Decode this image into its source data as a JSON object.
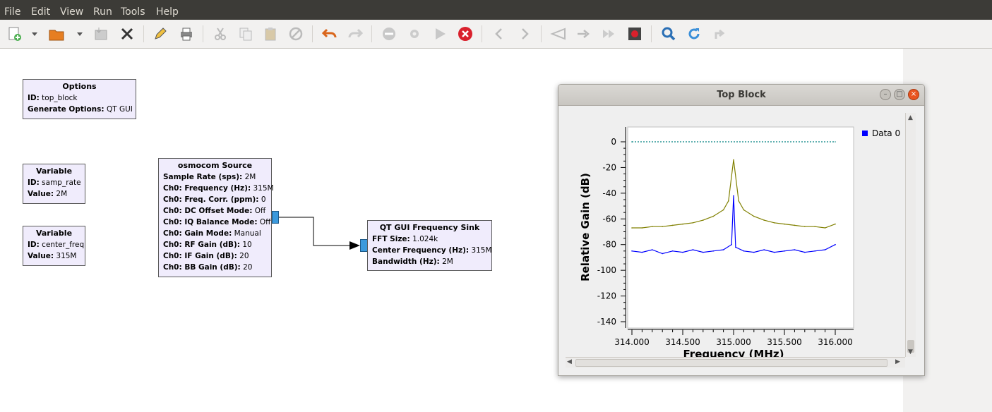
{
  "menu": [
    "File",
    "Edit",
    "View",
    "Run",
    "Tools",
    "Help"
  ],
  "toolbar_icons": [
    "new-icon",
    "dropdown-icon",
    "open-icon",
    "dropdown-icon",
    "save-icon",
    "close-icon",
    "edit-icon",
    "print-icon",
    "cut-icon",
    "copy-icon",
    "paste-icon",
    "disable-icon",
    "undo-icon",
    "redo-icon",
    "remove-icon",
    "settings-icon",
    "play-icon",
    "stop-icon",
    "back-icon",
    "forward-icon",
    "rotate-left-icon",
    "rotate-right-icon",
    "skip-icon",
    "record-icon",
    "search-icon",
    "reload-icon",
    "redo-alt-icon"
  ],
  "blocks": {
    "options": {
      "title": "Options",
      "rows": [
        {
          "k": "ID:",
          "v": "top_block"
        },
        {
          "k": "Generate Options:",
          "v": "QT GUI"
        }
      ]
    },
    "var_samp": {
      "title": "Variable",
      "rows": [
        {
          "k": "ID:",
          "v": "samp_rate"
        },
        {
          "k": "Value:",
          "v": "2M"
        }
      ]
    },
    "var_center": {
      "title": "Variable",
      "rows": [
        {
          "k": "ID:",
          "v": "center_freq"
        },
        {
          "k": "Value:",
          "v": "315M"
        }
      ]
    },
    "osmocom": {
      "title": "osmocom Source",
      "rows": [
        {
          "k": "Sample Rate (sps):",
          "v": "2M"
        },
        {
          "k": "Ch0: Frequency (Hz):",
          "v": "315M"
        },
        {
          "k": "Ch0: Freq. Corr. (ppm):",
          "v": "0"
        },
        {
          "k": "Ch0: DC Offset Mode:",
          "v": "Off"
        },
        {
          "k": "Ch0: IQ Balance Mode:",
          "v": "Off"
        },
        {
          "k": "Ch0: Gain Mode:",
          "v": "Manual"
        },
        {
          "k": "Ch0: RF Gain (dB):",
          "v": "10"
        },
        {
          "k": "Ch0: IF Gain (dB):",
          "v": "20"
        },
        {
          "k": "Ch0: BB Gain (dB):",
          "v": "20"
        }
      ]
    },
    "freq_sink": {
      "title": "QT GUI Frequency Sink",
      "rows": [
        {
          "k": "FFT Size:",
          "v": "1.024k"
        },
        {
          "k": "Center Frequency (Hz):",
          "v": "315M"
        },
        {
          "k": "Bandwidth (Hz):",
          "v": "2M"
        }
      ]
    }
  },
  "window": {
    "title": "Top Block"
  },
  "chart_data": {
    "type": "line",
    "xlabel": "Frequency (MHz)",
    "ylabel": "Relative Gain (dB)",
    "xlim": [
      314.0,
      316.0
    ],
    "ylim": [
      -140,
      0
    ],
    "x_ticks": [
      "314.000",
      "314.500",
      "315.000",
      "315.500",
      "316.000"
    ],
    "y_ticks": [
      "0",
      "-20",
      "-40",
      "-60",
      "-80",
      "-100",
      "-120",
      "-140"
    ],
    "legend": "right",
    "series": [
      {
        "name": "Data 0",
        "color": "#0000ff",
        "description_shape": "noise floor",
        "x": [
          314.0,
          314.1,
          314.2,
          314.3,
          314.4,
          314.5,
          314.6,
          314.7,
          314.8,
          314.9,
          314.98,
          315.0,
          315.02,
          315.1,
          315.2,
          315.3,
          315.4,
          315.5,
          315.6,
          315.7,
          315.8,
          315.9,
          316.0
        ],
        "y": [
          -85,
          -86,
          -84,
          -87,
          -85,
          -86,
          -84,
          -86,
          -85,
          -84,
          -80,
          -42,
          -82,
          -85,
          -86,
          -84,
          -86,
          -85,
          -84,
          -86,
          -85,
          -84,
          -80
        ]
      },
      {
        "color": "#808000",
        "x": [
          314.0,
          314.1,
          314.2,
          314.3,
          314.4,
          314.5,
          314.6,
          314.7,
          314.8,
          314.9,
          314.95,
          315.0,
          315.05,
          315.1,
          315.2,
          315.3,
          315.4,
          315.5,
          315.6,
          315.7,
          315.8,
          315.9,
          316.0
        ],
        "y": [
          -67,
          -67,
          -66,
          -66,
          -65,
          -64,
          -63,
          -61,
          -58,
          -53,
          -46,
          -14,
          -46,
          -53,
          -58,
          -61,
          -63,
          -64,
          -65,
          -66,
          -66,
          -67,
          -64
        ]
      },
      {
        "color": "#008080",
        "x": [
          314.0,
          316.0
        ],
        "y": [
          0,
          0
        ]
      }
    ]
  }
}
